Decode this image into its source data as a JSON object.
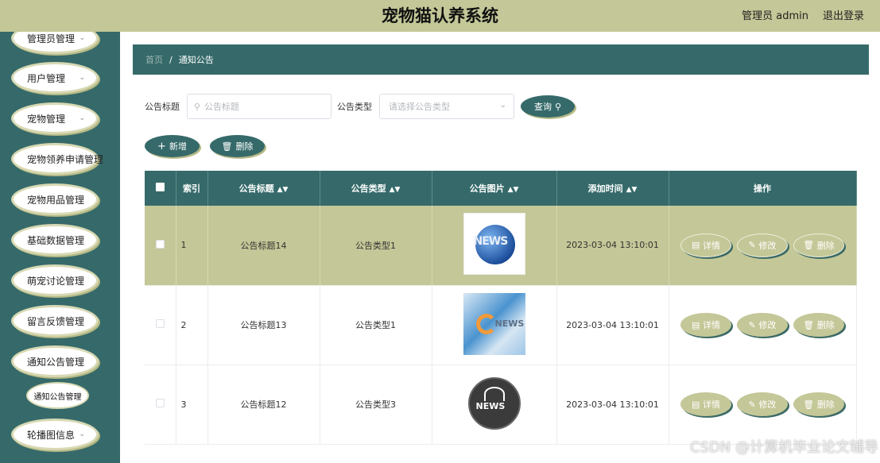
{
  "header": {
    "title": "宠物猫认养系统",
    "user_label": "管理员 admin",
    "logout_label": "退出登录"
  },
  "sidebar": {
    "items": [
      {
        "label": "管理员管理",
        "has_chevron": true
      },
      {
        "label": "用户管理",
        "has_chevron": true
      },
      {
        "label": "宠物管理",
        "has_chevron": true
      },
      {
        "label": "宠物领养申请管理",
        "has_chevron": false
      },
      {
        "label": "宠物用品管理",
        "has_chevron": false
      },
      {
        "label": "基础数据管理",
        "has_chevron": false
      },
      {
        "label": "萌宠讨论管理",
        "has_chevron": false
      },
      {
        "label": "留言反馈管理",
        "has_chevron": false
      },
      {
        "label": "通知公告管理",
        "has_chevron": false
      },
      {
        "label": "轮播图信息",
        "has_chevron": true
      }
    ],
    "sub_item": "通知公告管理"
  },
  "breadcrumb": {
    "home": "首页",
    "separator": "/",
    "current": "通知公告"
  },
  "search": {
    "title_label": "公告标题",
    "title_placeholder": "公告标题",
    "type_label": "公告类型",
    "type_placeholder": "请选择公告类型",
    "query_label": "查询"
  },
  "actions": {
    "add_label": "新增",
    "delete_label": "删除"
  },
  "table": {
    "columns": [
      "索引",
      "公告标题",
      "公告类型",
      "公告图片",
      "添加时间",
      "操作"
    ],
    "rows": [
      {
        "index": "1",
        "title": "公告标题14",
        "type": "公告类型1",
        "image_icon": "news-globe-image",
        "time": "2023-03-04 13:10:01",
        "highlighted": true
      },
      {
        "index": "2",
        "title": "公告标题13",
        "type": "公告类型1",
        "image_icon": "news-swirl-image",
        "time": "2023-03-04 13:10:01",
        "highlighted": false
      },
      {
        "index": "3",
        "title": "公告标题12",
        "type": "公告类型3",
        "image_icon": "news-badge-image",
        "time": "2023-03-04 13:10:01",
        "highlighted": false
      }
    ],
    "row_actions": {
      "detail": "详情",
      "edit": "修改",
      "delete": "删除"
    }
  },
  "watermark": "CSDN @计算机毕业论文辅导",
  "colors": {
    "primary": "#366a6a",
    "accent": "#c4c797",
    "topbar": "#c4c797"
  }
}
